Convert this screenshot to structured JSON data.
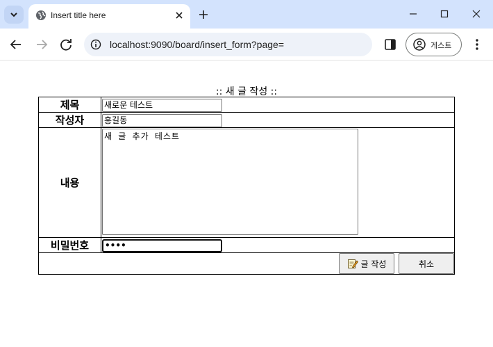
{
  "browser": {
    "tab_title": "Insert title here",
    "url": "localhost:9090/board/insert_form?page=",
    "profile_label": "게스트"
  },
  "page": {
    "heading": ":: 새 글 작성 ::"
  },
  "form": {
    "title_label": "제목",
    "title_value": "새로운 테스트",
    "writer_label": "작성자",
    "writer_value": "홍길동",
    "content_label": "내용",
    "content_value": "새 글 추가 테스트",
    "password_label": "비밀번호",
    "password_value": "••••",
    "submit_label": "글 작성",
    "cancel_label": "취소"
  },
  "icons": {
    "tab_search": "chevron-down-icon",
    "favicon": "globe-icon",
    "tab_close": "close-icon",
    "new_tab": "plus-icon",
    "back": "arrow-left-icon",
    "forward": "arrow-right-icon",
    "reload": "reload-icon",
    "site_info": "info-icon",
    "side_panel": "side-panel-icon",
    "profile": "account-icon",
    "menu": "kebab-menu-icon",
    "submit": "edit-memo-icon"
  },
  "colors": {
    "tabstrip": "#d3e3fd",
    "omnibox": "#eef2f9",
    "button_face": "#efefef"
  }
}
